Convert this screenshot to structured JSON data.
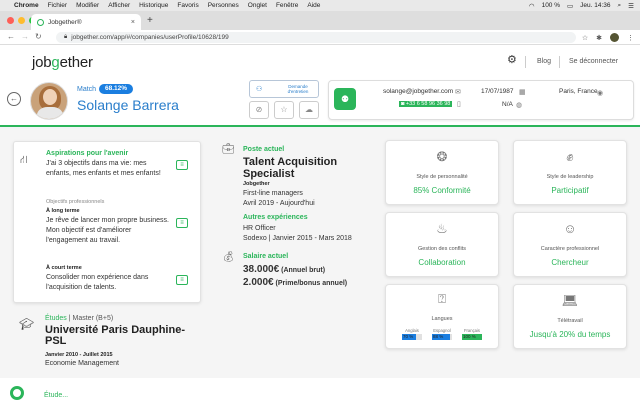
{
  "menubar": {
    "app": "Chrome",
    "items": [
      "Fichier",
      "Modifier",
      "Afficher",
      "Historique",
      "Favoris",
      "Personnes",
      "Onglet",
      "Fenêtre",
      "Aide"
    ],
    "battery": "100 %",
    "clock": "Jeu. 14:36"
  },
  "browser": {
    "tab_title": "Jobgether®",
    "url": "jobgether.com/app/#/companies/userProfile/10628/199"
  },
  "header": {
    "logo_prefix": "job",
    "logo_o": "g",
    "logo_suffix": "ether",
    "blog": "Blog",
    "logout": "Se déconnecter"
  },
  "profile": {
    "match_label": "Match",
    "match_value": "68.12%",
    "name": "Solange Barrera",
    "request_label": "Demande d'entretien",
    "email": "solange@jobgether.com",
    "phone": "+33 6 58 96 36 98",
    "dob": "17/07/1987",
    "na": "N/A",
    "city": "Paris, France"
  },
  "aspirations": {
    "title": "Aspirations pour l'avenir",
    "intro": "J'ai 3 objectifs dans ma vie: mes enfants, mes enfants et mes enfants!",
    "obj_label": "Objectifs professionnels",
    "long_label": "À long terme",
    "long_text": "Je rêve de lancer mon propre business. Mon objectif est d'améliorer l'engagement au travail.",
    "short_label": "À court terme",
    "short_text": "Consolider mon expérience dans l'acquisition de talents."
  },
  "education": {
    "label": "Études",
    "level": "Master (B+5)",
    "school": "Université Paris Dauphine-PSL",
    "dates": "Janvier 2010 - Juillet 2015",
    "field": "Economie Management"
  },
  "job": {
    "current_label": "Poste actuel",
    "title": "Talent Acquisition Specialist",
    "company": "Jobgether",
    "level": "First-line managers",
    "period": "Avril 2019 - Aujourd'hui",
    "other_label": "Autres expériences",
    "other_title": "HR Officer",
    "other_period": "Sodexo | Janvier 2015 - Mars 2018",
    "salary_label": "Salaire actuel",
    "salary_gross": "38.000€",
    "salary_gross_note": "(Annuel brut)",
    "salary_bonus": "2.000€",
    "salary_bonus_note": "(Prime/bonus annuel)"
  },
  "cards": {
    "personality_label": "Style de personnalité",
    "personality_value": "85% Conformité",
    "leadership_label": "Style de leadership",
    "leadership_value": "Participatif",
    "conflict_label": "Gestion des conflits",
    "conflict_value": "Collaboration",
    "character_label": "Caractère professionnel",
    "character_value": "Chercheur",
    "languages_label": "Langues",
    "languages": [
      {
        "name": "Anglais",
        "pct": "70 %",
        "level": 0.7,
        "color": "#1a7ee0"
      },
      {
        "name": "Espagnol",
        "pct": "88 %",
        "level": 0.88,
        "color": "#1a7ee0"
      },
      {
        "name": "Français",
        "pct": "100 %",
        "level": 1.0,
        "color": "#2bb55a"
      }
    ],
    "remote_label": "Télétravail",
    "remote_value": "Jusqu'à 20% du temps"
  },
  "footer": {
    "text": "Étude..."
  },
  "colors": {
    "green": "#2bb55a",
    "blue": "#1a7ee0"
  }
}
